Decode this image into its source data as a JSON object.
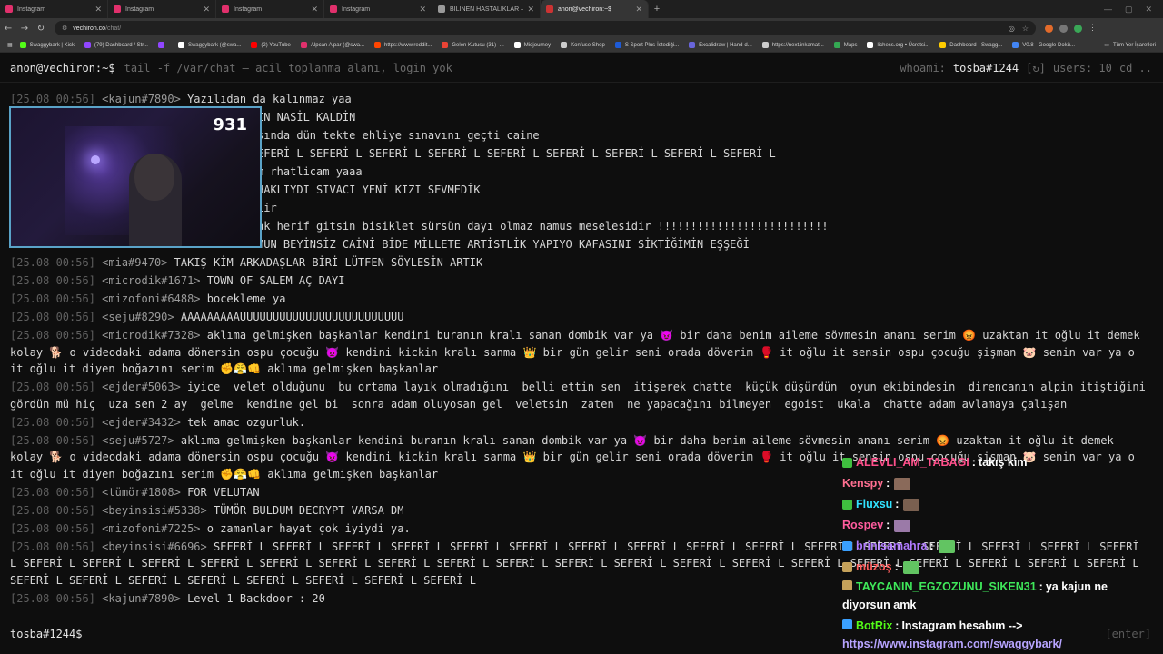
{
  "browser": {
    "tabs": [
      {
        "title": "Instagram",
        "color": "#e1306c"
      },
      {
        "title": "Instagram",
        "color": "#e1306c"
      },
      {
        "title": "Instagram",
        "color": "#e1306c"
      },
      {
        "title": "Instagram",
        "color": "#e1306c"
      },
      {
        "title": "BİLİNEN HASTALIKLAR — Bede",
        "color": "#9a9a9a"
      },
      {
        "title": "anon@vechiron:~$",
        "color": "#c33"
      }
    ],
    "url_host": "vechiron.co",
    "url_path": "/chat/",
    "bookmarks": [
      {
        "label": "Swaggybark | Kick",
        "color": "#53fc18"
      },
      {
        "label": "(79) Dashboard / Str...",
        "color": "#9146ff"
      },
      {
        "label": "",
        "color": "#9146ff"
      },
      {
        "label": "Swaggybark (@swa...",
        "color": "#ffffff"
      },
      {
        "label": "(2) YouTube",
        "color": "#ff0000"
      },
      {
        "label": "Alpcan Alpar (@swa...",
        "color": "#e1306c"
      },
      {
        "label": "https://www.reddit...",
        "color": "#ff4500"
      },
      {
        "label": "Gelen Kutusu (31) -...",
        "color": "#ea4335"
      },
      {
        "label": "Midjourney",
        "color": "#ffffff"
      },
      {
        "label": "Konfuse Shop",
        "color": "#cccccc"
      },
      {
        "label": "S Sport Plus-İstediği...",
        "color": "#1e5bd7"
      },
      {
        "label": "Excalidraw | Hand-d...",
        "color": "#6965db"
      },
      {
        "label": "https://next.inkamat...",
        "color": "#cccccc"
      },
      {
        "label": "Maps",
        "color": "#34a853"
      },
      {
        "label": "lichess.org • Ücretsi...",
        "color": "#ffffff"
      },
      {
        "label": "Dashboard - Swagg...",
        "color": "#ffcc00"
      },
      {
        "label": "V0.8 - Google Dokü...",
        "color": "#4285f4"
      }
    ],
    "bookmarks_right": "Tüm Yer İşaretleri"
  },
  "terminal": {
    "prompt": "anon@vechiron:~$",
    "command": "tail -f /var/chat — acil toplanma alanı, login yok",
    "whoami_label": "whoami:",
    "whoami_user": "tosba#1244",
    "refresh_label": "[↻]",
    "users_label": "users: 10",
    "cd_label": "cd ..",
    "input_prompt": "tosba#1244$",
    "input_value": "",
    "enter_label": "[enter]"
  },
  "messages": [
    {
      "ts": "[25.08 00:56]",
      "nick": "<kajun#7890>",
      "text": "Yazılıdan da kalınmaz yaa"
    },
    {
      "ts": "",
      "nick": "",
      "text": "İN NASİL KALDİN"
    },
    {
      "ts": "",
      "nick": "",
      "text": "şında dün tekte ehliye sınavını geçti caine"
    },
    {
      "ts": "",
      "nick": "",
      "text": "EFERİ L SEFERİ L SEFERİ L SEFERİ L SEFERİ L SEFERİ L SEFERİ L SEFERİ L SEFERİ L"
    },
    {
      "ts": "",
      "nick": "",
      "text": "m rhatlicam yaaa"
    },
    {
      "ts": "",
      "nick": "",
      "text": "HAKLIYDI SIVACI YENİ KIZI SEVMEDİK"
    },
    {
      "ts": "",
      "nick": "",
      "text": "lir"
    },
    {
      "ts": "",
      "nick": "",
      "text": "ak herif gitsin bisiklet sürsün dayı olmaz namus meselesidir !!!!!!!!!!!!!!!!!!!!!!!!!!"
    },
    {
      "ts": "",
      "nick": "",
      "text": "MUN BEYİNSİZ CAİNİ BİDE MİLLETE ARTİSTLİK YAPIYO KAFASINI SİKTİĞİMİN EŞŞEĞİ"
    },
    {
      "ts": "[25.08 00:56]",
      "nick": "<mia#9470>",
      "text": "TAKIŞ KİM ARKADAŞLAR BİRİ LÜTFEN SÖYLESİN ARTIK"
    },
    {
      "ts": "[25.08 00:56]",
      "nick": "<microdik#1671>",
      "text": "TOWN OF SALEM AÇ DAYI"
    },
    {
      "ts": "[25.08 00:56]",
      "nick": "<mizofoni#6488>",
      "text": "bocekleme ya"
    },
    {
      "ts": "[25.08 00:56]",
      "nick": "<seju#8290>",
      "text": "AAAAAAAAAUUUUUUUUUUUUUUUUUUUUUUUUU"
    },
    {
      "ts": "[25.08 00:56]",
      "nick": "<microdik#7328>",
      "text": "aklıma gelmişken başkanlar kendini buranın kralı sanan dombik var ya 😈 bir daha benim aileme sövmesin ananı serim 😡 uzaktan it oğlu it demek kolay 🐕 o videodaki adama dönersin ospu çocuğu 👿 kendini kickin kralı sanma 👑 bir gün gelir seni orada döverim 🥊 it oğlu it sensin ospu çocuğu şişman 🐷 senin var ya o it oğlu it diyen boğazını serim ✊😤👊 aklıma gelmişken başkanlar"
    },
    {
      "ts": "[25.08 00:56]",
      "nick": "<ejder#5063>",
      "text": "iyice  velet olduğunu  bu ortama layık olmadığını  belli ettin sen  itişerek chatte  küçük düşürdün  oyun ekibindesin  direncanın alpin itiştiğini gördün mü hiç  uza sen 2 ay  gelme  kendine gel bi  sonra adam oluyosan gel  veletsin  zaten  ne yapacağını bilmeyen  egoist  ukala  chatte adam avlamaya çalışan"
    },
    {
      "ts": "[25.08 00:56]",
      "nick": "<ejder#3432>",
      "text": "tek amac ozgurluk."
    },
    {
      "ts": "[25.08 00:56]",
      "nick": "<seju#5727>",
      "text": "aklıma gelmişken başkanlar kendini buranın kralı sanan dombik var ya 😈 bir daha benim aileme sövmesin ananı serim 😡 uzaktan it oğlu it demek kolay 🐕 o videodaki adama dönersin ospu çocuğu 👿 kendini kickin kralı sanma 👑 bir gün gelir seni orada döverim 🥊 it oğlu it sensin ospu çocuğu şişman 🐷 senin var ya o it oğlu it diyen boğazını serim ✊😤👊 aklıma gelmişken başkanlar"
    },
    {
      "ts": "[25.08 00:56]",
      "nick": "<tümör#1808>",
      "text": "FOR VELUTAN"
    },
    {
      "ts": "[25.08 00:56]",
      "nick": "<beyinsisi#5338>",
      "text": "TÜMÖR BULDUM DECRYPT VARSA DM"
    },
    {
      "ts": "[25.08 00:56]",
      "nick": "<mizofoni#7225>",
      "text": "o zamanlar hayat çok iyiydi ya."
    },
    {
      "ts": "[25.08 00:56]",
      "nick": "<beyinsisi#6696>",
      "text": "SEFERİ L SEFERİ L SEFERİ L SEFERİ L SEFERİ L SEFERİ L SEFERİ L SEFERİ L SEFERİ L SEFERİ L SEFERİ L SEFERİ L SEFERİ L SEFERİ L SEFERİ L SEFERİ L SEFERİ L SEFERİ L SEFERİ L SEFERİ L SEFERİ L SEFERİ L SEFERİ L SEFERİ L SEFERİ L SEFERİ L SEFERİ L SEFERİ L SEFERİ L SEFERİ L SEFERİ L SEFERİ L SEFERİ L SEFERİ L SEFERİ L SEFERİ L SEFERİ L SEFERİ L SEFERİ L SEFERİ L SEFERİ L SEFERİ L SEFERİ L"
    },
    {
      "ts": "[25.08 00:56]",
      "nick": "<kajun#7890>",
      "text": "Level 1 Backdoor : 20"
    }
  ],
  "webcam": {
    "viewer_count": "931"
  },
  "stream_chat": [
    {
      "user": "ALEVLI_AM_TABAGI",
      "color": "#ff4f8b",
      "badge": "#3fbf3f",
      "text": "takış kim",
      "emote": ""
    },
    {
      "user": "Kenspy",
      "color": "#ff6f91",
      "badge": "",
      "text": "",
      "emote": "#8a6a5a"
    },
    {
      "user": "Fluxsu",
      "color": "#31e3ff",
      "badge": "#3fbf3f",
      "text": "",
      "emote": "#7a6050"
    },
    {
      "user": "Rospev",
      "color": "#ff5c9e",
      "badge": "",
      "text": "",
      "emote": "#9b7aa8"
    },
    {
      "user": "brinisamahra",
      "color": "#b07aff",
      "badge": "#3aa0ff",
      "text": "",
      "emote": "#62c462"
    },
    {
      "user": "müzoş",
      "color": "#ff5c5c",
      "badge": "#c4a15a",
      "text": "",
      "emote": "#62c462"
    },
    {
      "user": "TAYCANIN_EGZOZUNU_SIKEN31",
      "color": "#3fe85a",
      "badge": "#c4a15a",
      "text": "ya kajun ne diyorsun amk",
      "emote": ""
    },
    {
      "user": "BotRix",
      "color": "#53fc18",
      "badge": "#3aa0ff",
      "text": "Instagram hesabım -->",
      "emote": "",
      "link": "https://www.instagram.com/swaggybark/"
    }
  ]
}
